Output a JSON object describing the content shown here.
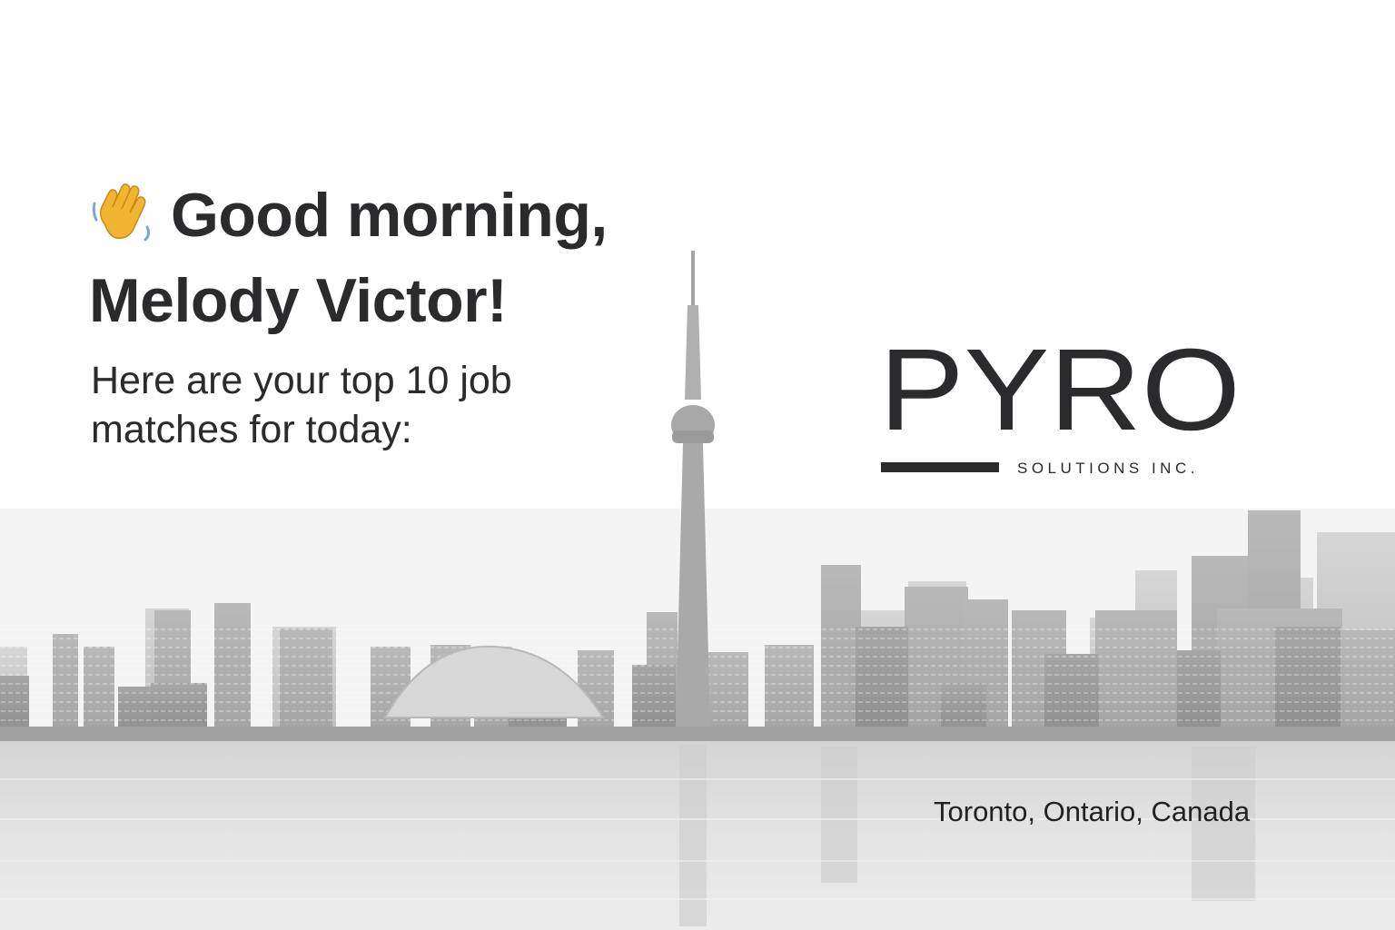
{
  "greeting": {
    "line1": "Good morning,",
    "line2": "Melody Victor!",
    "icon": "waving-hand-icon",
    "icon_color": "#F2B531"
  },
  "subtitle": {
    "line1": "Here are your top 10 job",
    "line2": "matches for today:"
  },
  "brand": {
    "name": "PYRO",
    "tagline": "SOLUTIONS INC.",
    "color": "#2b2b2d"
  },
  "location": "Toronto, Ontario, Canada",
  "colors": {
    "text": "#2b2b2d",
    "skyline": "#9a9a9a",
    "water": "#dcdcdc"
  }
}
